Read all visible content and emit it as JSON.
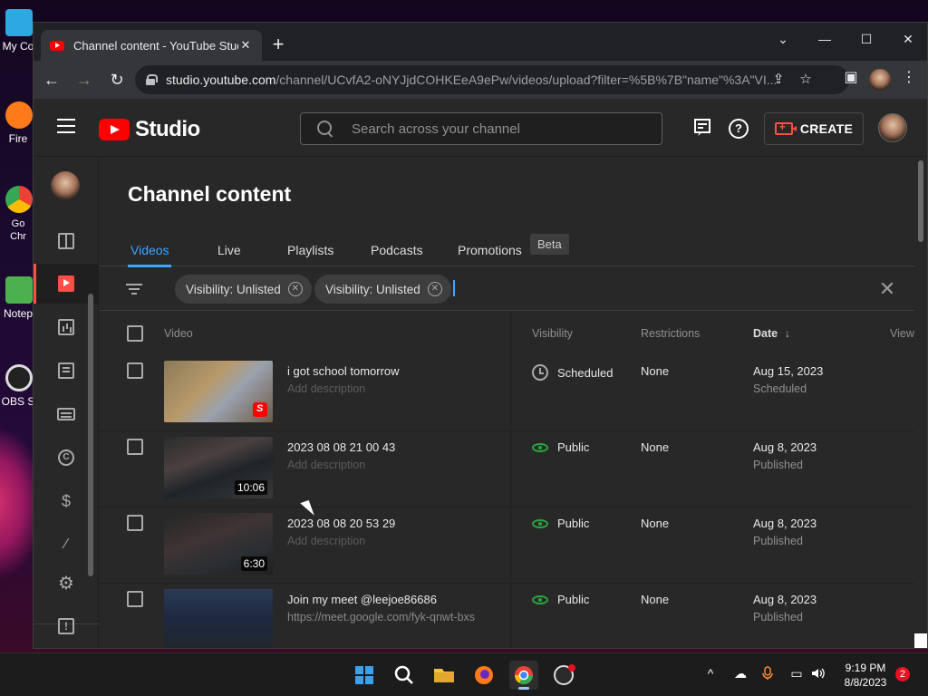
{
  "desktop": {
    "icons": [
      {
        "label": "My Co",
        "icon": "monitor-icon",
        "color": "#2ea8e0"
      },
      {
        "label": "Fire",
        "icon": "firefox-icon",
        "color": "#ff7a18"
      },
      {
        "label": "Go\nChr",
        "icon": "chrome-icon",
        "color": "#34a853"
      },
      {
        "label": "Notep",
        "icon": "notepad-icon",
        "color": "#4cb04c"
      },
      {
        "label": "OBS S",
        "icon": "obs-icon",
        "color": "#222222"
      }
    ]
  },
  "browser": {
    "tab_title": "Channel content - YouTube Studio",
    "tab_close": "✕",
    "new_tab": "+",
    "window_controls": {
      "dropdown": "⌄",
      "minimize": "—",
      "maximize": "☐",
      "close": "✕"
    },
    "nav": {
      "back": "←",
      "forward": "→",
      "reload": "↻"
    },
    "url_host": "studio.youtube.com",
    "url_rest": "/channel/UCvfA2-oNYJjdCOHKEeA9ePw/videos/upload?filter=%5B%7B\"name\"%3A\"VI...",
    "omni_icons": {
      "share": "⇪",
      "star": "☆"
    },
    "toolbar_icons": {
      "sidepanel": "▣",
      "menu": "⋮"
    }
  },
  "studio": {
    "logo_text": "Studio",
    "search_placeholder": "Search across your channel",
    "create_label": "CREATE",
    "page_title": "Channel content",
    "tabs": [
      {
        "label": "Videos",
        "active": true
      },
      {
        "label": "Live",
        "active": false
      },
      {
        "label": "Playlists",
        "active": false
      },
      {
        "label": "Podcasts",
        "active": false
      },
      {
        "label": "Promotions",
        "active": false
      }
    ],
    "beta_badge": "Beta",
    "filters": [
      {
        "label": "Visibility: Unlisted"
      },
      {
        "label": "Visibility: Unlisted"
      }
    ],
    "filter_chip_close": "✕",
    "filter_clear": "✕",
    "columns": {
      "video": "Video",
      "visibility": "Visibility",
      "restrictions": "Restrictions",
      "date": "Date",
      "sort_icon": "↓",
      "views": "View"
    },
    "rows": [
      {
        "title": "i got school tomorrow",
        "desc": "Add description",
        "visibility": "Scheduled",
        "vis_icon": "clock-icon",
        "restrictions": "None",
        "date": "Aug 15, 2023",
        "date_sub": "Scheduled",
        "duration": "",
        "short": true
      },
      {
        "title": "2023 08 08 21 00 43",
        "desc": "Add description",
        "visibility": "Public",
        "vis_icon": "eye-icon",
        "restrictions": "None",
        "date": "Aug 8, 2023",
        "date_sub": "Published",
        "duration": "10:06",
        "short": false
      },
      {
        "title": "2023 08 08 20 53 29",
        "desc": "Add description",
        "visibility": "Public",
        "vis_icon": "eye-icon",
        "restrictions": "None",
        "date": "Aug 8, 2023",
        "date_sub": "Published",
        "duration": "6:30",
        "short": false
      },
      {
        "title": "Join my meet @leejoe86686",
        "desc": "https://meet.google.com/fyk-qnwt-bxs",
        "visibility": "Public",
        "vis_icon": "eye-icon",
        "restrictions": "None",
        "date": "Aug 8, 2023",
        "date_sub": "Published",
        "duration": "",
        "short": false
      }
    ],
    "sidebar_icons": [
      "dashboard-icon",
      "content-icon",
      "analytics-icon",
      "comments-icon",
      "subtitles-icon",
      "copyright-icon",
      "earn-icon",
      "customization-icon",
      "settings-icon",
      "feedback-icon"
    ],
    "accent_color": "#3ea6ff",
    "brand_color": "#ff0000"
  },
  "taskbar": {
    "apps": [
      "start-icon",
      "search-icon",
      "file-explorer-icon",
      "firefox-icon",
      "chrome-icon",
      "obs-icon"
    ],
    "tray": {
      "chevron": "^",
      "network": "☁",
      "mic": "🎤",
      "display": "▭",
      "volume": "🔊"
    },
    "time": "9:19 PM",
    "date": "8/8/2023",
    "notification_count": "2"
  }
}
